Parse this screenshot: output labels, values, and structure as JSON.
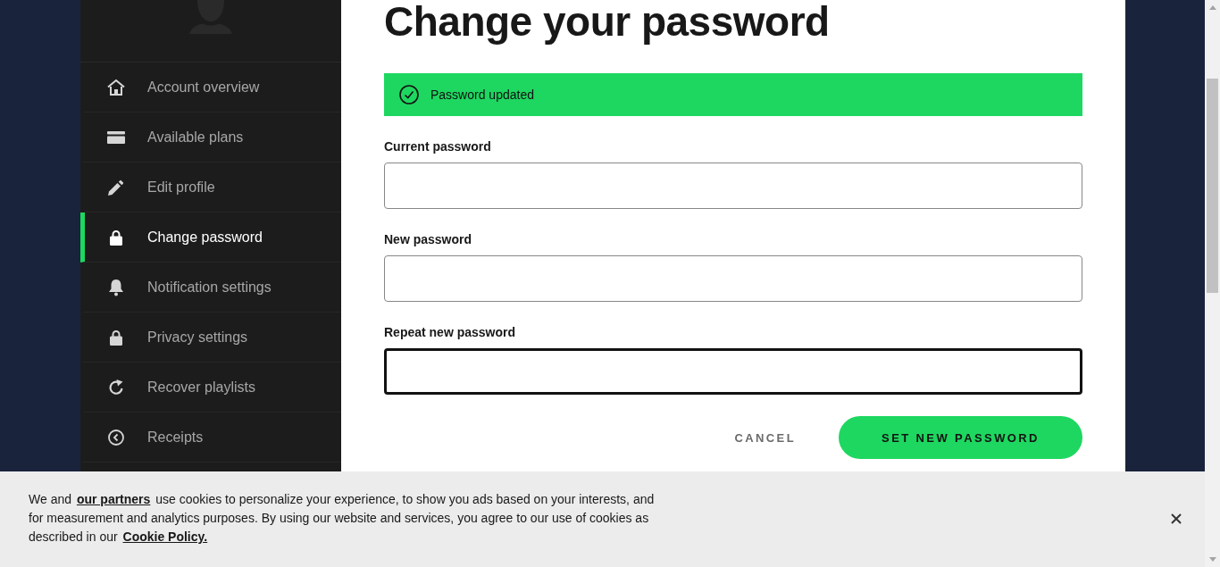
{
  "sidebar": {
    "items": [
      {
        "label": "Account overview",
        "selected": false
      },
      {
        "label": "Available plans",
        "selected": false
      },
      {
        "label": "Edit profile",
        "selected": false
      },
      {
        "label": "Change password",
        "selected": true
      },
      {
        "label": "Notification settings",
        "selected": false
      },
      {
        "label": "Privacy settings",
        "selected": false
      },
      {
        "label": "Recover playlists",
        "selected": false
      },
      {
        "label": "Receipts",
        "selected": false
      }
    ]
  },
  "page": {
    "title": "Change your password"
  },
  "alert": {
    "kind": "success",
    "text": "Password updated"
  },
  "form": {
    "fields": [
      {
        "label": "Current password",
        "focused": false
      },
      {
        "label": "New password",
        "focused": false
      },
      {
        "label": "Repeat new password",
        "focused": true
      }
    ],
    "buttons": [
      {
        "label": "CANCEL",
        "kind": "secondary"
      },
      {
        "label": "SET NEW PASSWORD",
        "kind": "primary"
      }
    ]
  },
  "cookie_banner": {
    "segments": [
      {
        "kind": "text",
        "text": "We and "
      },
      {
        "kind": "link",
        "text": "our partners"
      },
      {
        "kind": "text",
        "text": " use cookies to personalize your experience, to show you ads based on your interests, and for measurement and analytics purposes. By using our website and services, you agree to our use of cookies as described in our "
      },
      {
        "kind": "link",
        "text": "Cookie Policy."
      }
    ]
  }
}
